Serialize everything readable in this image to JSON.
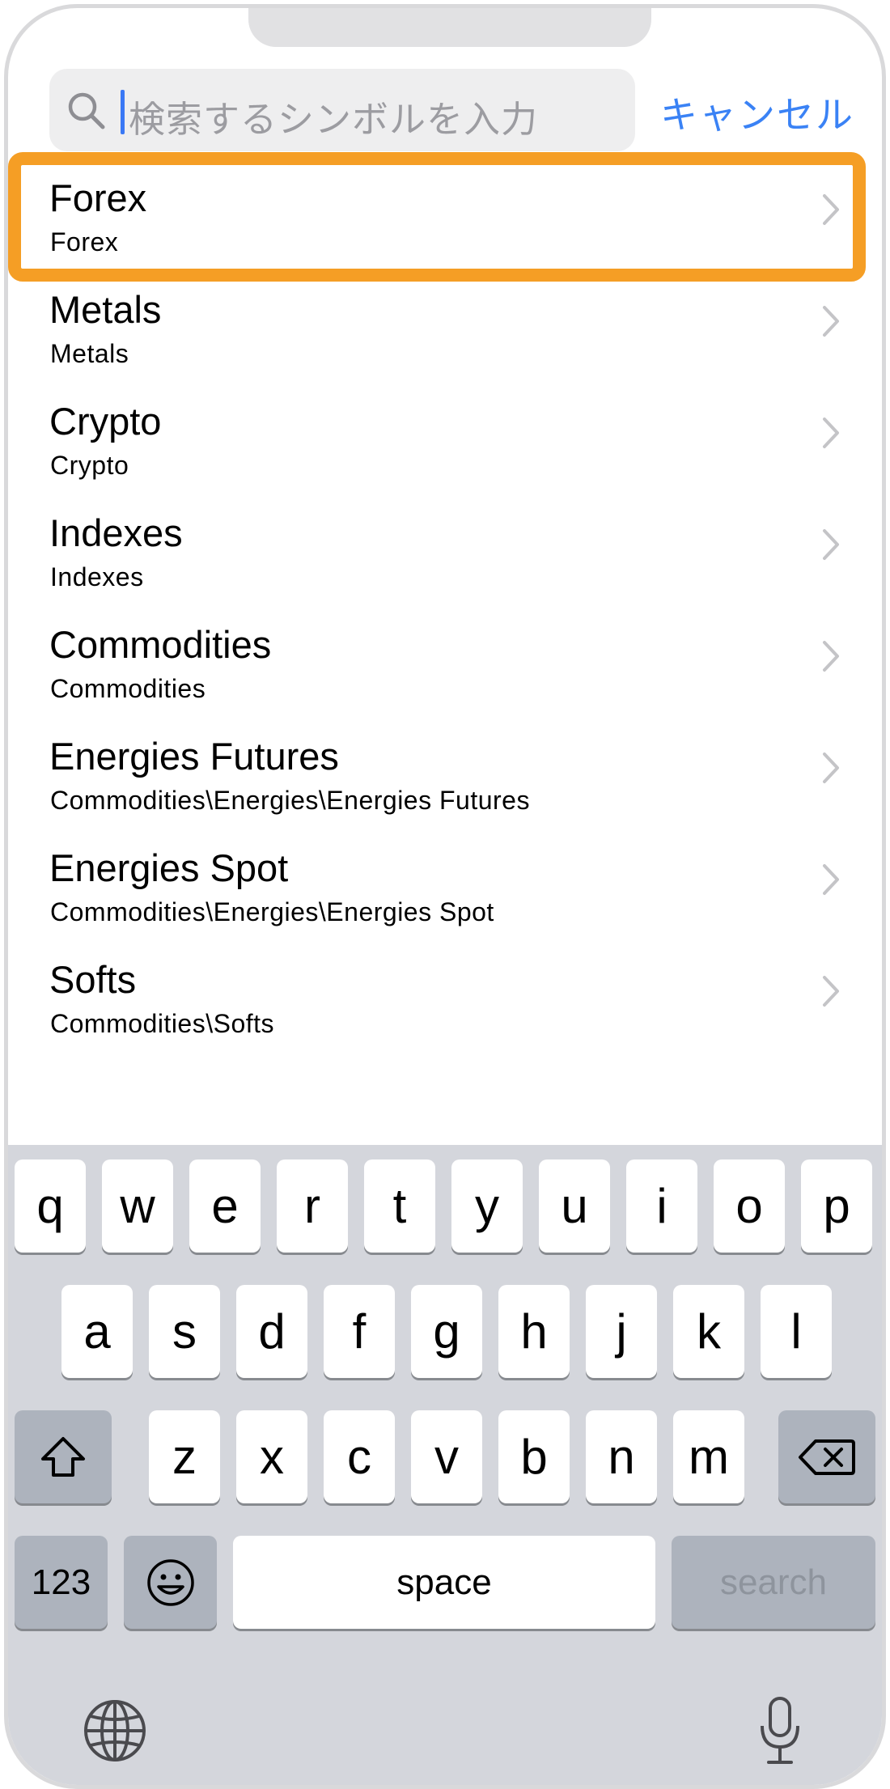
{
  "search": {
    "placeholder": "検索するシンボルを入力",
    "cancel_label": "キャンセル"
  },
  "list": {
    "items": [
      {
        "title": "Forex",
        "subtitle": "Forex"
      },
      {
        "title": "Metals",
        "subtitle": "Metals"
      },
      {
        "title": "Crypto",
        "subtitle": "Crypto"
      },
      {
        "title": "Indexes",
        "subtitle": "Indexes"
      },
      {
        "title": "Commodities",
        "subtitle": "Commodities"
      },
      {
        "title": "Energies Futures",
        "subtitle": "Commodities\\Energies\\Energies Futures"
      },
      {
        "title": "Energies Spot",
        "subtitle": "Commodities\\Energies\\Energies Spot"
      },
      {
        "title": "Softs",
        "subtitle": "Commodities\\Softs"
      }
    ],
    "highlighted_index": 0,
    "highlight_color": "#f59e25"
  },
  "keyboard": {
    "row1": [
      "q",
      "w",
      "e",
      "r",
      "t",
      "y",
      "u",
      "i",
      "o",
      "p"
    ],
    "row2": [
      "a",
      "s",
      "d",
      "f",
      "g",
      "h",
      "j",
      "k",
      "l"
    ],
    "row3": [
      "z",
      "x",
      "c",
      "v",
      "b",
      "n",
      "m"
    ],
    "numbers_label": "123",
    "space_label": "space",
    "search_label": "search",
    "icons": {
      "shift": "shift-icon",
      "delete": "delete-icon",
      "emoji": "emoji-icon",
      "globe": "globe-icon",
      "mic": "microphone-icon"
    }
  },
  "colors": {
    "accent": "#3a82f5",
    "keyboard_bg": "#d4d6dc"
  }
}
